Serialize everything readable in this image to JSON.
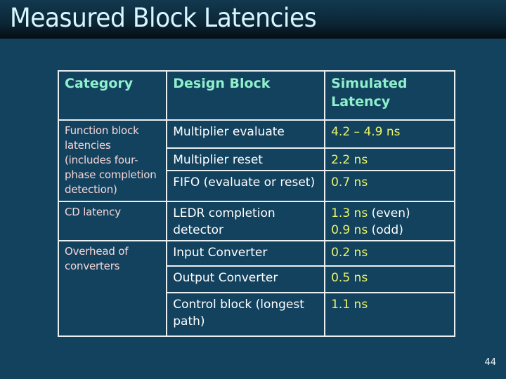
{
  "slide": {
    "title": "Measured Block Latencies",
    "page_number": "44"
  },
  "table": {
    "headers": [
      "Category",
      "Design Block",
      "Simulated Latency"
    ],
    "groups": [
      {
        "category": "Function block latencies (includes four-phase completion detection)",
        "rows": [
          {
            "block": "Multiplier evaluate",
            "latency": "4.2 – 4.9 ns"
          },
          {
            "block": "Multiplier reset",
            "latency": "2.2 ns"
          },
          {
            "block": "FIFO (evaluate or reset)",
            "latency": "0.7 ns"
          }
        ]
      },
      {
        "category": "CD latency",
        "rows": [
          {
            "block": "LEDR completion detector",
            "latency_lines": [
              {
                "value": "1.3 ns",
                "note": "(even)"
              },
              {
                "value": "0.9 ns",
                "note": "(odd)"
              }
            ]
          }
        ]
      },
      {
        "category": "Overhead of converters",
        "rows": [
          {
            "block": "Input Converter",
            "latency": "0.2 ns"
          },
          {
            "block": "Output Converter",
            "latency": "0.5 ns"
          },
          {
            "block": "Control block (longest path)",
            "latency": "1.1 ns"
          }
        ]
      }
    ]
  },
  "colors": {
    "background": "#13425f",
    "header_text": "#8ff0cc",
    "category_text": "#f6d7d6",
    "block_text": "#ffffff",
    "latency_text": "#e9f56a"
  }
}
